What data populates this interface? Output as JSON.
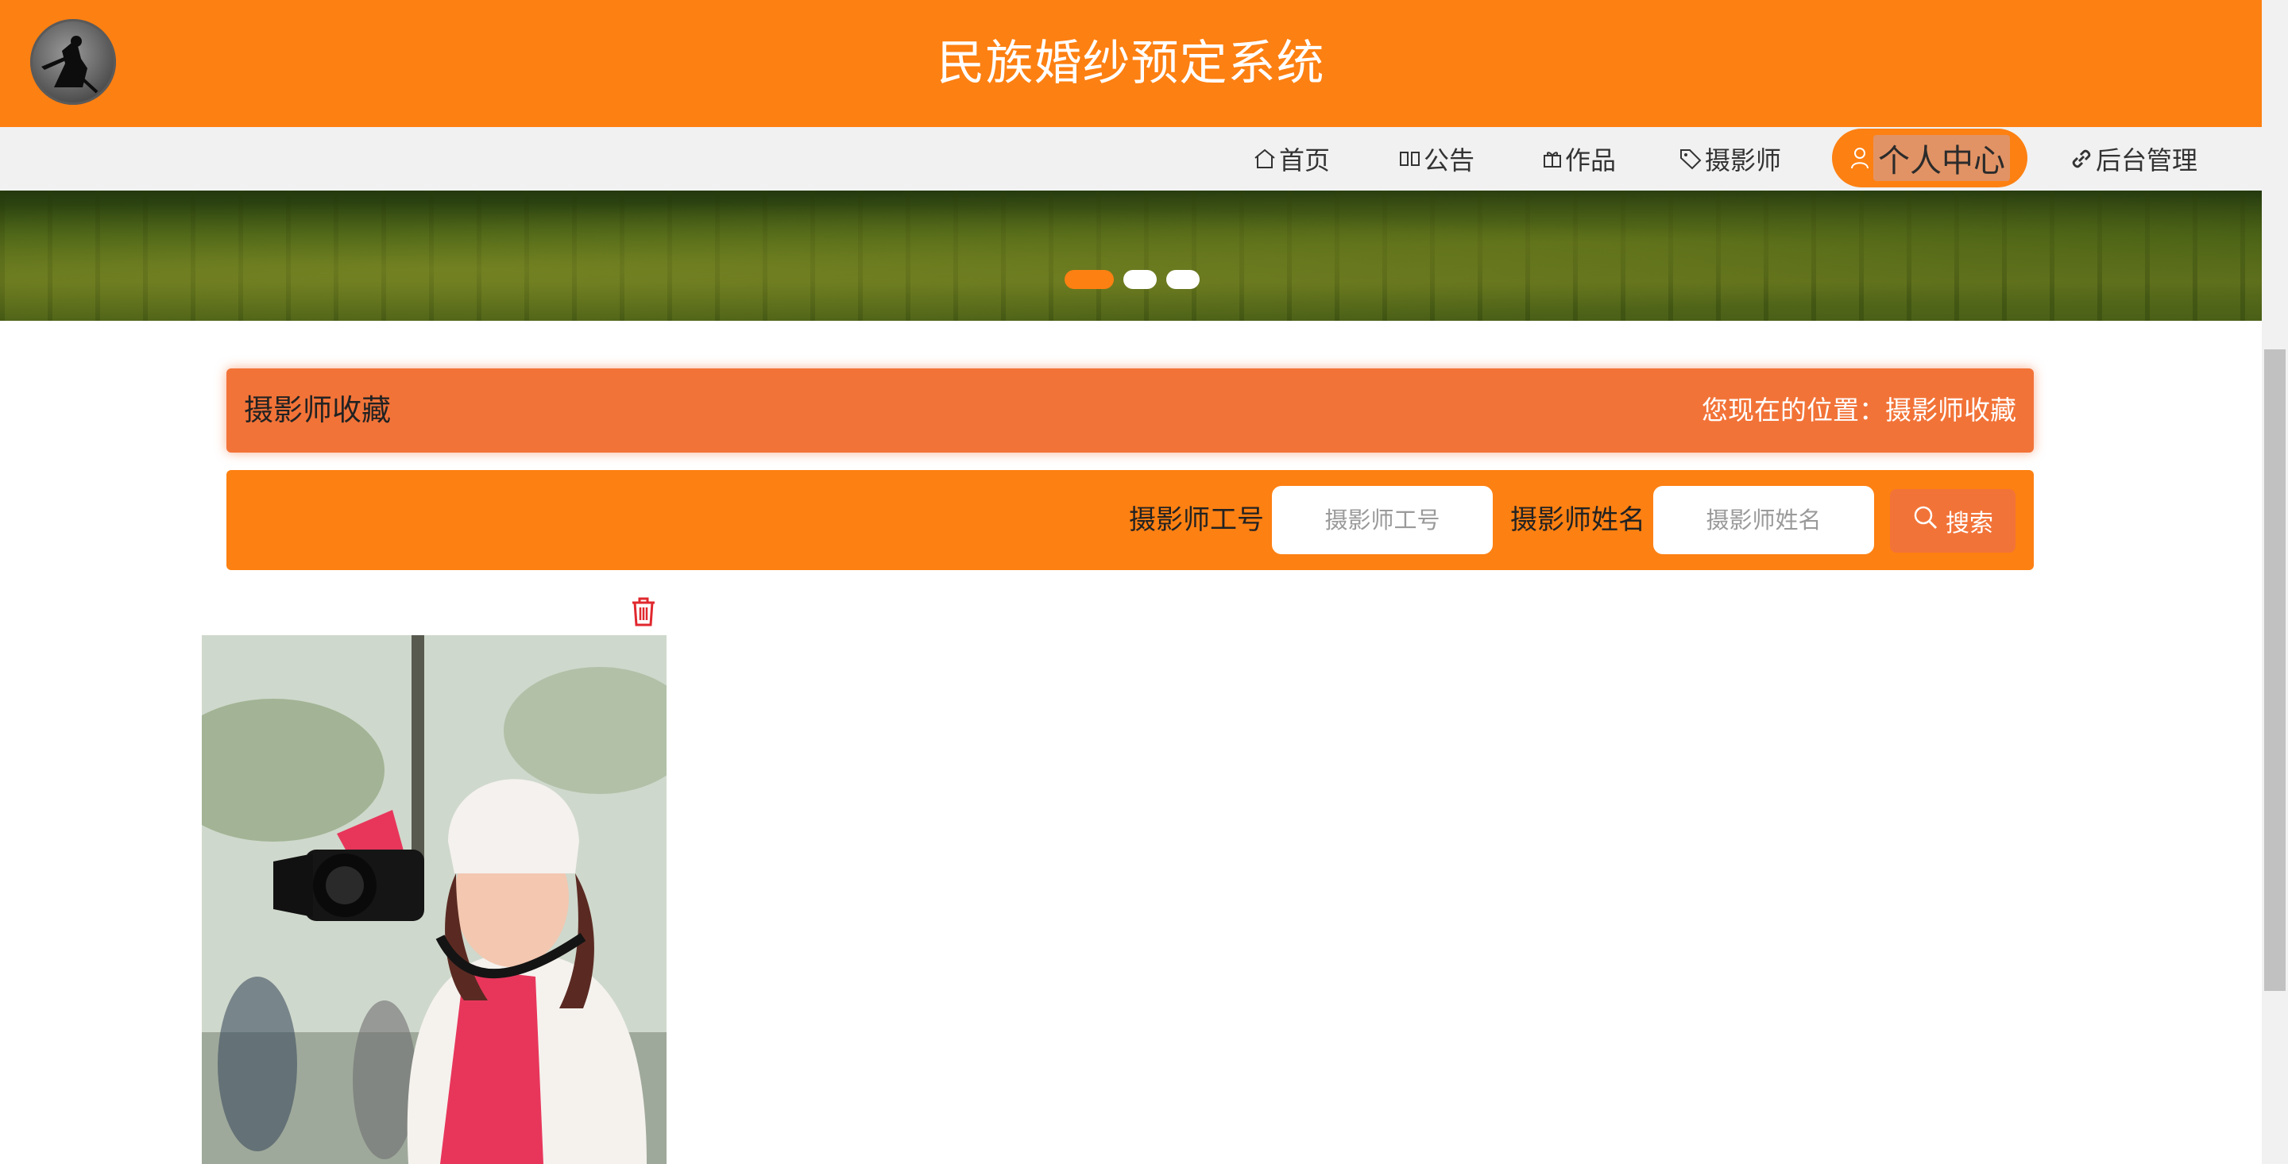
{
  "header": {
    "site_title": "民族婚纱预定系统",
    "logo_icon": "photographer-silhouette-logo",
    "brand_color": "#fd8012"
  },
  "nav": {
    "items": [
      {
        "label": "首页",
        "icon": "home-icon"
      },
      {
        "label": "公告",
        "icon": "announcement-icon"
      },
      {
        "label": "作品",
        "icon": "gift-icon"
      },
      {
        "label": "摄影师",
        "icon": "tag-icon"
      },
      {
        "label": "个人中心",
        "icon": "user-icon",
        "active": true
      },
      {
        "label": "后台管理",
        "icon": "link-icon"
      }
    ]
  },
  "banner": {
    "slides": 3,
    "active_slide": 1
  },
  "page": {
    "title": "摄影师收藏",
    "breadcrumb": "您现在的位置：摄影师收藏",
    "title_bar_color": "#f27338"
  },
  "search": {
    "field1_label": "摄影师工号",
    "field1_placeholder": "摄影师工号",
    "field2_label": "摄影师姓名",
    "field2_placeholder": "摄影师姓名",
    "button_label": "搜索",
    "button_icon": "search-icon"
  },
  "results": [
    {
      "image": "photographer-with-camera-photo",
      "action_icon": "trash-icon",
      "action_color": "#e0282e"
    }
  ]
}
